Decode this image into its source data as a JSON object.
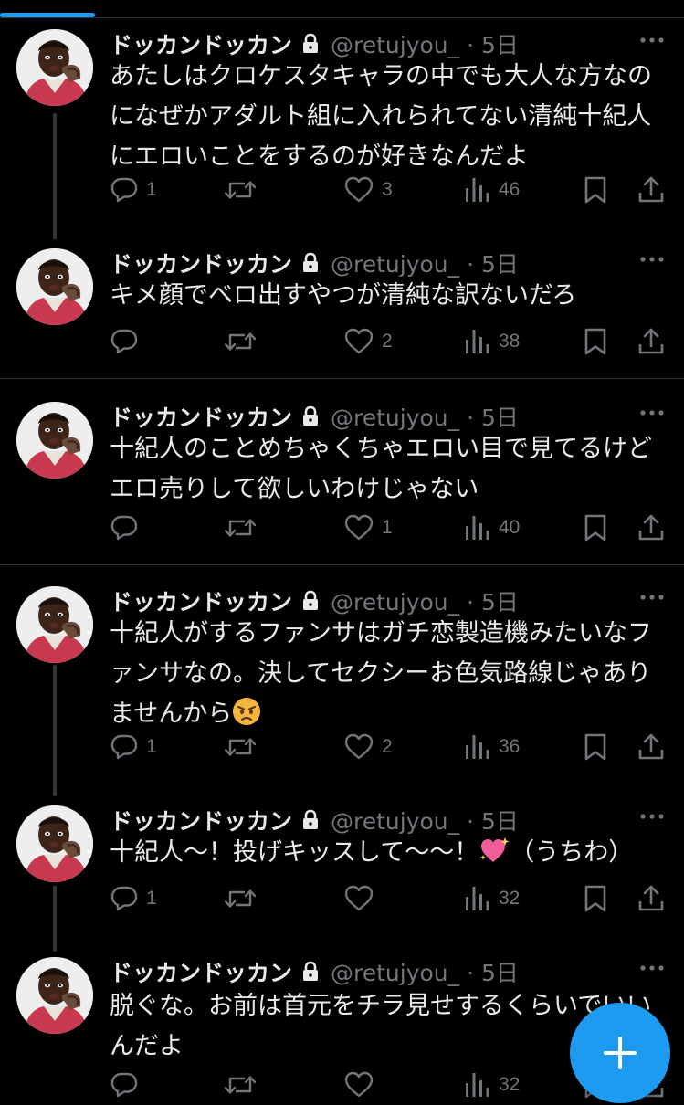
{
  "tweets": [
    {
      "name": "ドッカンドッカン",
      "handle": "@retujyou_",
      "time": "5日",
      "text": "あたしはクロケスタキャラの中でも大人な方なのになぜかアダルト組に入れられてない清純十紀人にエロいことをするのが好きなんだよ",
      "replies": "1",
      "retweets": "",
      "likes": "3",
      "views": "46"
    },
    {
      "name": "ドッカンドッカン",
      "handle": "@retujyou_",
      "time": "5日",
      "text": "キメ顔でベロ出すやつが清純な訳ないだろ",
      "replies": "",
      "retweets": "",
      "likes": "2",
      "views": "38"
    },
    {
      "name": "ドッカンドッカン",
      "handle": "@retujyou_",
      "time": "5日",
      "text": "十紀人のことめちゃくちゃエロい目で見てるけどエロ売りして欲しいわけじゃない",
      "replies": "",
      "retweets": "",
      "likes": "1",
      "views": "40"
    },
    {
      "name": "ドッカンドッカン",
      "handle": "@retujyou_",
      "time": "5日",
      "text": "十紀人がするファンサはガチ恋製造機みたいなファンサなの。決してセクシーお色気路線じゃありませんから",
      "emoji": "angry-face-emoji",
      "replies": "1",
      "retweets": "",
      "likes": "2",
      "views": "36"
    },
    {
      "name": "ドッカンドッカン",
      "handle": "@retujyou_",
      "time": "5日",
      "text_before": "十紀人〜！投げキッスして〜〜！",
      "emoji": "sparkling-heart-emoji",
      "text_after": "（うちわ）",
      "replies": "1",
      "retweets": "",
      "likes": "",
      "views": "32"
    },
    {
      "name": "ドッカンドッカン",
      "handle": "@retujyou_",
      "time": "5日",
      "text": "脱ぐな。お前は首元をチラ見せするくらいでいいんだよ",
      "replies": "",
      "retweets": "",
      "likes": "",
      "views": "32"
    }
  ],
  "time_separator": " · ",
  "fab": {
    "icon": "plus-icon",
    "color": "#1d9bf0"
  },
  "colors": {
    "background": "#000000",
    "text": "#e7e9ea",
    "secondary": "#71767b",
    "divider": "#2f3336",
    "accent": "#1d9bf0"
  }
}
